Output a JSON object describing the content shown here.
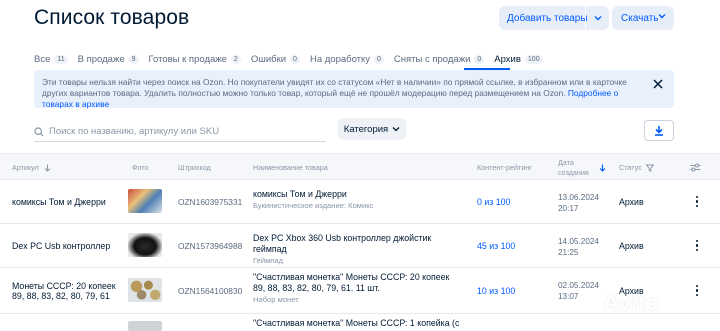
{
  "header": {
    "title": "Список товаров",
    "add_button": "Добавить товары",
    "download_button": "Скачать"
  },
  "tabs": [
    {
      "label": "Все",
      "count": "11"
    },
    {
      "label": "В продаже",
      "count": "9"
    },
    {
      "label": "Готовы к продаже",
      "count": "2"
    },
    {
      "label": "Ошибки",
      "count": "0"
    },
    {
      "label": "На доработку",
      "count": "0"
    },
    {
      "label": "Сняты с продажи",
      "count": "0"
    },
    {
      "label": "Архив",
      "count": "100",
      "active": true
    }
  ],
  "banner": {
    "text": "Эти товары нельзя найти через поиск на Ozon. Но покупатели увидят их со статусом «Нет в наличии» по прямой ссылке, в избранном или в карточке других вариантов товара. Удалить полностью можно только товар, который ещё не прошёл модерацию перед размещением на Ozon.",
    "link": "Подробнее о товарах в архиве"
  },
  "filters": {
    "search_placeholder": "Поиск по названию, артикулу или SKU",
    "category_label": "Категория"
  },
  "table": {
    "headers": {
      "article": "Артикул",
      "photo": "Фото",
      "barcode": "Штрихкод",
      "name": "Наименование товара",
      "rating": "Контент-рейтинг",
      "date_line1": "Дата",
      "date_line2": "создания",
      "status": "Статус"
    },
    "rows": [
      {
        "article": "комиксы Том и Джерри",
        "barcode": "OZN1603975331",
        "name": "комиксы Том и Джерри",
        "subtitle": "Букинистическое издание: Комикс",
        "rating": "0 из 100",
        "date": "13.06.2024",
        "time": "20:17",
        "status": "Архив"
      },
      {
        "article": "Dex PC Usb контроллер",
        "barcode": "OZN1573964988",
        "name": "Dex PC Xbox 360 Usb контроллер джойстик геймпад",
        "subtitle": "Геймпад",
        "rating": "45 из 100",
        "date": "14.05.2024",
        "time": "21:25",
        "status": "Архив"
      },
      {
        "article": "Монеты СССР: 20 копеек 89, 88, 83, 82, 80, 79, 61",
        "barcode": "OZN1564100830",
        "name": "\"Счастливая монетка\" Монеты СССР: 20 копеек 89, 88, 83, 82, 80, 79, 61. 11 шт.",
        "subtitle": "Набор монет",
        "rating": "10 из 100",
        "date": "02.05.2024",
        "time": "13:07",
        "status": "Архив"
      },
      {
        "article": "",
        "barcode": "",
        "name": "\"Счастливая монетка\" Монеты СССР: 1 копейка (с",
        "subtitle": "",
        "rating": "",
        "date": "",
        "time": "",
        "status": ""
      }
    ]
  },
  "watermark": "Avito",
  "colors": {
    "accent": "#005bff",
    "banner_bg": "#e8f0fc",
    "button_bg": "#e8eef8"
  }
}
